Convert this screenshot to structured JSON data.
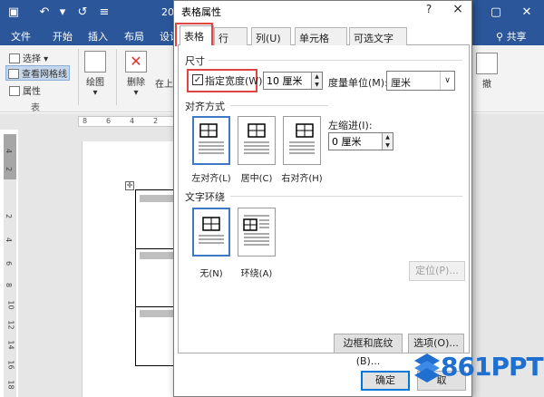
{
  "word": {
    "doc_title_prefix": "20",
    "menu": [
      "文件",
      "开始",
      "插入",
      "布局",
      "设计"
    ],
    "share": "共享",
    "ribbon": {
      "select": "选择",
      "view_gridlines": "查看网格线",
      "properties": "属性",
      "group_table": "表",
      "draw": "绘图",
      "delete": "删除",
      "insert_above": "在上",
      "partial_right": "撤"
    },
    "ruler_numbers": [
      "8",
      "6",
      "4",
      "2"
    ],
    "vruler_numbers": [
      "4",
      "2",
      "2",
      "4",
      "6",
      "8",
      "10",
      "12",
      "14",
      "16",
      "18"
    ]
  },
  "dialog": {
    "title": "表格属性",
    "help": "?",
    "close": "×",
    "tabs": [
      "表格(T)",
      "行(R)",
      "列(U)",
      "单元格(E)",
      "可选文字(A)"
    ],
    "active_tab": 0,
    "size": {
      "section": "尺寸",
      "specify_width_label": "指定宽度(W):",
      "specify_width_checked": true,
      "width_value": "10 厘米",
      "measure_label": "度量单位(M):",
      "measure_value": "厘米"
    },
    "alignment": {
      "section": "对齐方式",
      "options": [
        "左对齐(L)",
        "居中(C)",
        "右对齐(H)"
      ],
      "selected": 0,
      "indent_label": "左缩进(I):",
      "indent_value": "0 厘米"
    },
    "wrapping": {
      "section": "文字环绕",
      "options": [
        "无(N)",
        "环绕(A)"
      ],
      "selected": 0,
      "position_button": "定位(P)..."
    },
    "buttons": {
      "borders": "边框和底纹(B)...",
      "options": "选项(O)...",
      "ok": "确定",
      "cancel": "取"
    }
  },
  "watermark": "861PPT",
  "colors": {
    "word_blue": "#2b579a",
    "highlight_red": "#e04444",
    "select_blue": "#3d79c4"
  }
}
